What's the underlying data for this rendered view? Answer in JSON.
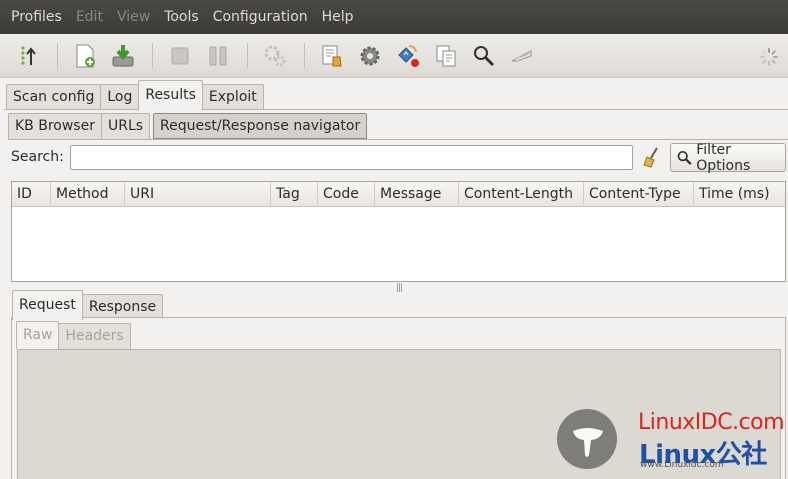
{
  "menubar": {
    "items": [
      {
        "label": "Profiles",
        "enabled": true
      },
      {
        "label": "Edit",
        "enabled": false
      },
      {
        "label": "View",
        "enabled": false
      },
      {
        "label": "Tools",
        "enabled": true
      },
      {
        "label": "Configuration",
        "enabled": true
      },
      {
        "label": "Help",
        "enabled": true
      }
    ]
  },
  "toolbar": {
    "icons": [
      "wizard-icon",
      "new-profile-icon",
      "save-profile-icon",
      "stop-icon",
      "pause-icon",
      "plugins-icon",
      "manual-request-icon",
      "settings-icon",
      "fuzzy-request-icon",
      "compare-icon",
      "encode-icon",
      "proxy-icon",
      "busy-spinner-icon"
    ]
  },
  "main_tabs": [
    "Scan config",
    "Log",
    "Results",
    "Exploit"
  ],
  "results_tabs": [
    "KB Browser",
    "URLs",
    "Request/Response navigator"
  ],
  "search": {
    "label": "Search:",
    "value": "",
    "filter_button": "Filter Options"
  },
  "table": {
    "columns": [
      "ID",
      "Method",
      "URI",
      "Tag",
      "Code",
      "Message",
      "Content-Length",
      "Content-Type",
      "Time (ms)"
    ],
    "rows": []
  },
  "detail_tabs": [
    "Request",
    "Response"
  ],
  "sub_tabs": [
    "Raw",
    "Headers"
  ],
  "watermark": {
    "top": "LinuxIDC.com",
    "bottom": "Linux公社",
    "small": "www.Linuxidc.com"
  },
  "colors": {
    "menubar_bg": "#3c3b37",
    "window_bg": "#f2f1ef",
    "watermark_red": "#d9261c",
    "watermark_blue": "#1f4fa8"
  }
}
